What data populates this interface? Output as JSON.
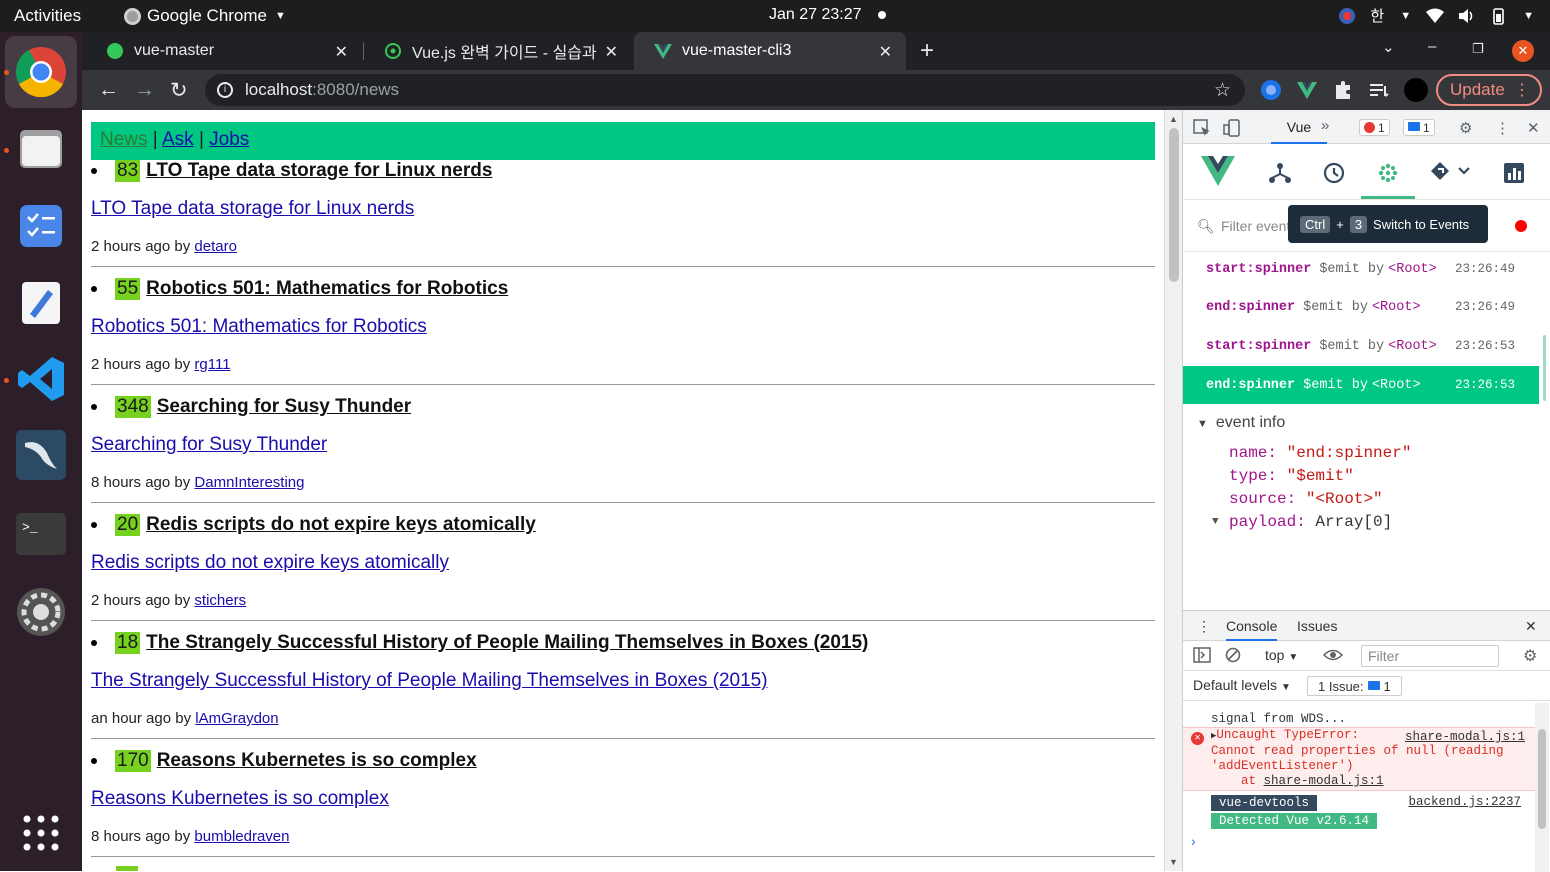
{
  "os_topbar": {
    "activities": "Activities",
    "app_name": "Google Chrome",
    "datetime": "Jan 27  23:27",
    "input_method": "한"
  },
  "browser": {
    "tabs": [
      {
        "title": "vue-master",
        "active": false
      },
      {
        "title": "Vue.js 완벽 가이드 - 실습과",
        "active": false
      },
      {
        "title": "vue-master-cli3",
        "active": true
      }
    ],
    "url_host": "localhost",
    "url_path": ":8080/news",
    "update_label": "Update"
  },
  "page": {
    "nav": {
      "news": "News",
      "ask": "Ask",
      "jobs": "Jobs",
      "sep1": "|",
      "sep2": "|"
    },
    "items": [
      {
        "points": "83",
        "title": "LTO Tape data storage for Linux nerds",
        "link": "LTO Tape data storage for Linux nerds",
        "time": "2 hours ago by",
        "user": "detaro"
      },
      {
        "points": "55",
        "title": "Robotics 501: Mathematics for Robotics",
        "link": "Robotics 501: Mathematics for Robotics",
        "time": "2 hours ago by",
        "user": "rg111"
      },
      {
        "points": "348",
        "title": "Searching for Susy Thunder",
        "link": "Searching for Susy Thunder",
        "time": "8 hours ago by",
        "user": "DamnInteresting"
      },
      {
        "points": "20",
        "title": "Redis scripts do not expire keys atomically",
        "link": "Redis scripts do not expire keys atomically",
        "time": "2 hours ago by",
        "user": "stichers"
      },
      {
        "points": "18",
        "title": "The Strangely Successful History of People Mailing Themselves in Boxes (2015)",
        "link": "The Strangely Successful History of People Mailing Themselves in Boxes (2015)",
        "time": "an hour ago by",
        "user": "lAmGraydon"
      },
      {
        "points": "170",
        "title": "Reasons Kubernetes is so complex",
        "link": "Reasons Kubernetes is so complex",
        "time": "8 hours ago by",
        "user": "bumbledraven"
      }
    ]
  },
  "devtools": {
    "vue_tab": "Vue",
    "error_count": "1",
    "message_count": "1",
    "filter_placeholder": "Filter event",
    "tooltip": {
      "key1": "Ctrl",
      "plus": "+",
      "key2": "3",
      "text": "Switch to Events"
    },
    "events": [
      {
        "name": "start:spinner",
        "type": "$emit by",
        "source": "<Root>",
        "time": "23:26:49",
        "selected": false
      },
      {
        "name": "end:spinner",
        "type": "$emit by",
        "source": "<Root>",
        "time": "23:26:49",
        "selected": false
      },
      {
        "name": "start:spinner",
        "type": "$emit by",
        "source": "<Root>",
        "time": "23:26:53",
        "selected": false
      },
      {
        "name": "end:spinner",
        "type": "$emit by",
        "source": "<Root>",
        "time": "23:26:53",
        "selected": true
      }
    ],
    "event_info": {
      "header": "event info",
      "name_key": "name:",
      "name_val": "\"end:spinner\"",
      "type_key": "type:",
      "type_val": "\"$emit\"",
      "source_key": "source:",
      "source_val": "\"<Root>\"",
      "payload_key": "payload:",
      "payload_val": "Array[0]"
    },
    "console": {
      "tab_console": "Console",
      "tab_issues": "Issues",
      "context": "top",
      "filter_placeholder": "Filter",
      "levels": "Default levels",
      "issue_chip": "1 Issue:",
      "issue_count": "1",
      "warn_tail": "signal from WDS...",
      "error_line1": "Uncaught TypeError:",
      "error_src": "share-modal.js:1",
      "error_line2": "Cannot read properties of null (reading",
      "error_line3": "'addEventListener')",
      "error_at": "at",
      "error_at_src": "share-modal.js:1",
      "devtools_pill": "vue-devtools",
      "devtools_src": "backend.js:2237",
      "detected": "Detected Vue v2.6.14"
    }
  }
}
